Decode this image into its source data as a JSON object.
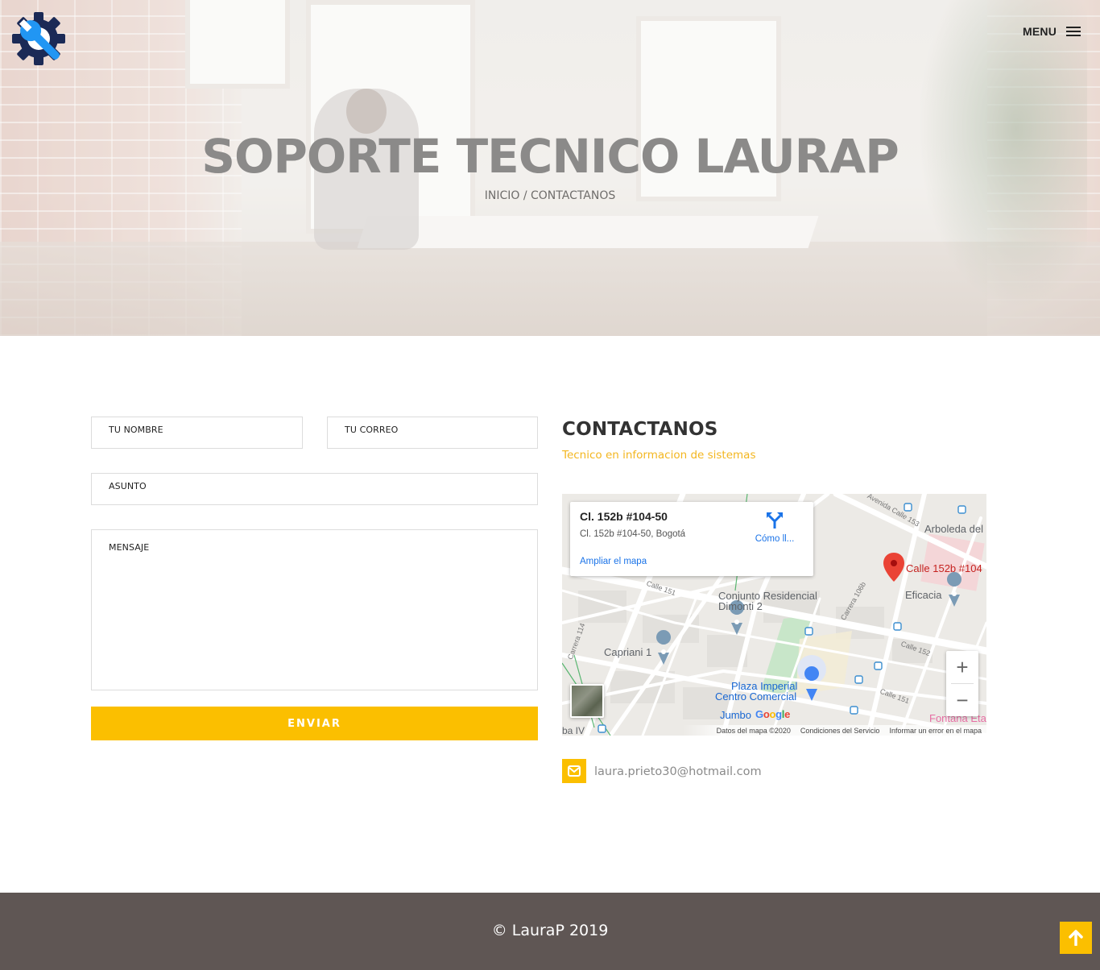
{
  "header": {
    "menu_label": "MENU",
    "logo_icon": "gear-wrench-icon"
  },
  "hero": {
    "title": "SOPORTE TECNICO LAURAP",
    "breadcrumb": {
      "home": "INICIO",
      "separator": " / ",
      "current": "CONTACTANOS"
    }
  },
  "form": {
    "name_placeholder": "TU NOMBRE",
    "email_placeholder": "TU CORREO",
    "subject_placeholder": "ASUNTO",
    "message_placeholder": "MENSAJE",
    "submit_label": "ENVIAR"
  },
  "contact": {
    "title": "CONTACTANOS",
    "subtitle": "Tecnico en informacion de sistemas",
    "email": "laura.prieto30@hotmail.com"
  },
  "map": {
    "card_title": "Cl. 152b #104-50",
    "card_address": "Cl. 152b #104-50, Bogotá",
    "directions_label": "Cómo ll...",
    "enlarge_label": "Ampliar el mapa",
    "marker_label": "Calle 152b #104",
    "places": {
      "arboleda": "Arboleda del",
      "eficacia": "Eficacia",
      "conjunto_1": "Conjunto Residencial",
      "conjunto_2": "Dimonti 2",
      "capriani": "Capriani 1",
      "plaza_1": "Plaza Imperial",
      "plaza_2": "Centro Comercial",
      "jumbo": "Jumbo",
      "fontana": "Fontana Eta",
      "ba_iv": "ba IV"
    },
    "streets": {
      "av_calle_153": "Avenida Calle 153",
      "calle_151": "Calle 151",
      "carrera_106b": "Carrera 106b",
      "calle_152": "Calle 152",
      "carrera_114": "Carrera 114",
      "calle_151b": "Calle 151"
    },
    "attribution": [
      "Datos del mapa ©2020",
      "Condiciones del Servicio",
      "Informar un error en el mapa"
    ],
    "brand": "Google",
    "zoom_in": "+",
    "zoom_out": "−",
    "colors": {
      "marker": "#ea4335",
      "link": "#1a73e8",
      "park": "#c8e6c9",
      "road": "#ffffff"
    }
  },
  "footer": {
    "copyright": "© LauraP 2019"
  },
  "colors": {
    "accent": "#fbbf00",
    "footer_bg": "#5f5654",
    "logo_dark": "#1b2a56",
    "logo_light": "#2196f3"
  }
}
